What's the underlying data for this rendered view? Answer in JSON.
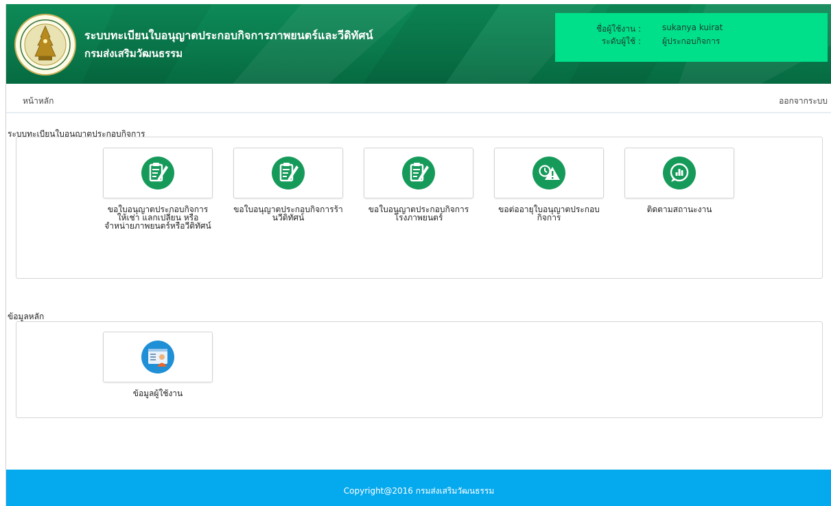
{
  "header": {
    "title_line1": "ระบบทะเบียนใบอนุญาตประกอบกิจการภาพยนตร์และวีดิทัศน์",
    "title_line2": "กรมส่งเสริมวัฒนธรรม",
    "user_label": "ชื่อผู้ใช้งาน :",
    "user_value": "sukanya kuirat",
    "level_label": "ระดับผู้ใช้ :",
    "level_value": "ผู้ประกอบกิจการ"
  },
  "nav": {
    "home": "หน้าหลัก",
    "logout": "ออกจากระบบ"
  },
  "license_section": {
    "title": "ระบบทะเบียนใบอนุญาตประกอบกิจการ",
    "tiles": [
      {
        "label": "ขอใบอนุญาตประกอบกิจการให้เช่า แลกเปลี่ยน หรือจำหน่ายภาพยนตร์หรือวีดิทัศน์",
        "icon": "document-pen-icon"
      },
      {
        "label": "ขอใบอนุญาตประกอบกิจการร้านวีดิทัศน์",
        "icon": "document-pen-icon"
      },
      {
        "label": "ขอใบอนุญาตประกอบกิจการโรงภาพยนตร์",
        "icon": "document-pen-icon"
      },
      {
        "label": "ขอต่ออายุใบอนุญาตประกอบกิจการ",
        "icon": "clock-warning-icon"
      },
      {
        "label": "ติดตามสถานะงาน",
        "icon": "chat-chart-icon"
      }
    ]
  },
  "master_section": {
    "title": "ข้อมูลหลัก",
    "tiles": [
      {
        "label": "ข้อมูลผู้ใช้งาน",
        "icon": "user-profile-icon"
      }
    ]
  },
  "footer": {
    "copyright": "Copyright@2016 กรมส่งเสริมวัฒนธรรม"
  },
  "colors": {
    "header_green": "#0a7a4c",
    "userbox_green": "#00e08a",
    "icon_green": "#169a5a",
    "icon_blue": "#1f8fd6",
    "footer_blue": "#05a9ee"
  }
}
